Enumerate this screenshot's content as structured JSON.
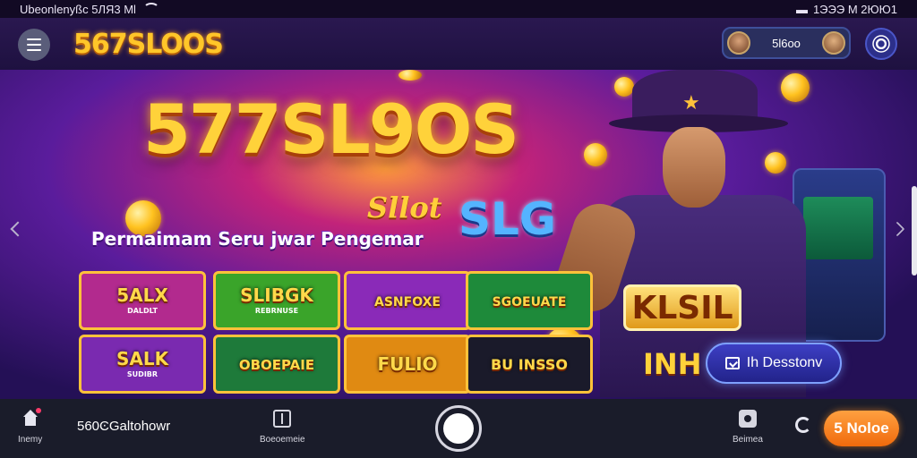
{
  "status_bar": {
    "carrier": "Ubeonlenyßc 5ЛЯ3 Ml",
    "time": "1ЭЭЭ M 2ЮЮ1"
  },
  "header": {
    "logo": "567SLOOS",
    "balance": "5l6oo"
  },
  "banner": {
    "title": "577SL9OS",
    "slot_word": "Sllot",
    "slg_word": "SLG",
    "tagline": "Permaimam Seru jwar Pengemar",
    "tiles": [
      {
        "title": "5ALX",
        "subtitle": "DALDLT",
        "bg": "#b22a8e"
      },
      {
        "title": "SLIBGK",
        "subtitle": "REBRNUSE",
        "bg": "#3aa42a"
      },
      {
        "title": "ASNFOXE",
        "subtitle": "",
        "bg": "#8a2ab8"
      },
      {
        "title": "SGOEUATE",
        "subtitle": "",
        "bg": "#1e8a3a"
      },
      {
        "title": "SALK",
        "subtitle": "SUDIBR",
        "bg": "#7a2ab0"
      },
      {
        "title": "OBOEPAIE",
        "subtitle": "",
        "bg": "#1e7a3a"
      },
      {
        "title": "FULIO",
        "subtitle": "",
        "bg": "#e08a12"
      },
      {
        "title": "BU INSSO",
        "subtitle": "",
        "bg": "#1a1a2a"
      }
    ],
    "hero_badge": "KLSIL",
    "hero_badge2": "INH",
    "cta_label": "Ih Desstonv"
  },
  "bottom_nav": {
    "home_label": "Inemy",
    "username": "560ϾGaltohowr",
    "bonus_label": "Boeoemeie",
    "camera_label": "Beimea",
    "join_label": "5 Noloe"
  }
}
